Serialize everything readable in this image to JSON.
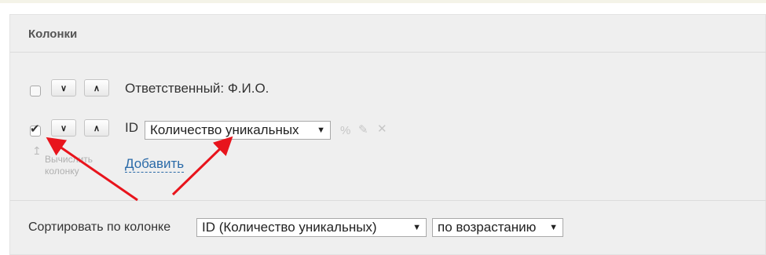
{
  "section": {
    "title": "Колонки"
  },
  "columns": [
    {
      "checked": false,
      "label": "Ответственный: Ф.И.О."
    },
    {
      "checked": true,
      "label": "ID",
      "aggregate": "Количество уникальных",
      "tools": [
        "percent-icon",
        "edit-icon",
        "delete-icon"
      ]
    }
  ],
  "hint": {
    "text": "Вычислить колонку"
  },
  "add_link": "Добавить",
  "sort": {
    "label": "Сортировать по колонке",
    "column_value": "ID (Количество уникальных)",
    "order_value": "по возрастанию"
  },
  "annotation": {
    "arrow_color": "#e8141c"
  },
  "icons": {
    "move_down": "▾",
    "move_up": "▴",
    "checkmark": "✔",
    "caret": "▼"
  }
}
